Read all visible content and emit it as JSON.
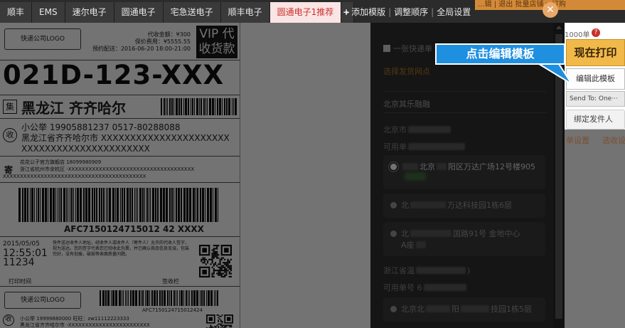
{
  "tabs": [
    {
      "label": "顺丰",
      "active": false
    },
    {
      "label": "EMS",
      "active": false
    },
    {
      "label": "速尔电子",
      "active": false
    },
    {
      "label": "圆通电子",
      "active": false
    },
    {
      "label": "宅急送电子",
      "active": false
    },
    {
      "label": "顺丰电子",
      "active": false
    },
    {
      "label": "圆通电子1推荐",
      "active": true
    }
  ],
  "tab_more": "▸",
  "tab_actions": {
    "add": "添加模版",
    "reorder": "调整顺序",
    "settings": "全局设置",
    "sep": "|",
    "plus": "+"
  },
  "background_strip": "...辑 | 退出   批量店铺 ▾  订购",
  "close_glyph": "✕",
  "waybill": {
    "logo": "快递公司LOGO",
    "cod": "代收金额：¥300",
    "insured": "保价费用：¥5555.55",
    "appointment": "预约配送：2016-06-20 18:00-21:00",
    "vip_line1": "VIP 代",
    "vip_line2": "收货款",
    "code": "021D-123-XXX",
    "ji_tag": "集",
    "dest_city": "黑龙江 齐齐哈尔",
    "recv_tag": "收",
    "recv_line1": "小公举   19905881237   0517-80288088",
    "recv_line2": "黑龙江省齐齐哈尔市 XXXXXXXXXXXXXXXXXXXXXX",
    "recv_line3": "XXXXXXXXXXXXXXXXXXXXXX",
    "send_tag": "寄",
    "send_line1": "花花公子官方旗舰店  18099980909",
    "send_line2": "浙江省杭州市余杭区 -XXXXXXXXXXXXXXXXXXXXXXXXXXXXXXXXXXXXX",
    "send_line3": "XXXXXXXXXXXXXXXXXXXXXXXXXXXXXXXXXXXXXXXXXX",
    "tracking": "AFC7150124715012 42 XXXX",
    "date": "2015/05/05",
    "time": "12:55:01",
    "time_sub": "11234",
    "terms": "快件送达收件人地址，经收件人或收件人（寄件人）允许的代收人签字，视为送达。您的签字代表您已验收此包裹，并已确认商品信息无误，包装完好，没有划痕，破损等表面质量问题。",
    "print_time_label": "打印时间",
    "sign_label": "签收栏",
    "logo2": "快递公司LOGO",
    "tracking2": "AFC7150124715012424",
    "recv2_line1": "小公举  19999880000  旺旺：zw11112223333",
    "recv2_line2": "黑龙江省齐齐哈尔市 -XXXXXXXXXXXXXXXXXXXXXXXX"
  },
  "panel": {
    "checkbox_label": "一张快递单",
    "select_site": "选择发货网点",
    "group1_title": "北京其乐融融",
    "group1_city": "北京市",
    "group1_avail": "可用单",
    "addr1": "北京",
    "addr1_tail": "阳区万达广场12号楼905",
    "addr2": "北",
    "addr2_tail": "万达科技园1栋6层",
    "addr3": "北",
    "addr3_tail": "国路91号 金地中心",
    "addr3_line2": "A座",
    "group2_city": "浙江省温",
    "group2_city_tail": ")",
    "group2_avail": "可用单号 6",
    "addr4": "北京北",
    "addr4_mid": "阳",
    "addr4_tail": "技园1栋5层"
  },
  "right": {
    "hint": "1000单",
    "badge": "?",
    "print": "现在打印",
    "edit": "编辑此模板",
    "send": "Send To: One···",
    "bind": "绑定发件人",
    "bottom_left": "单设置",
    "bottom_right": "选收设置"
  },
  "callout": "点击编辑模板",
  "colors": {
    "active_tab_bg": "#fbe4e4",
    "active_tab_text": "#c9302c",
    "print_button": "#f0b94a",
    "callout_bg": "#1f8fe0",
    "panel_bg": "#2f2f2f"
  }
}
